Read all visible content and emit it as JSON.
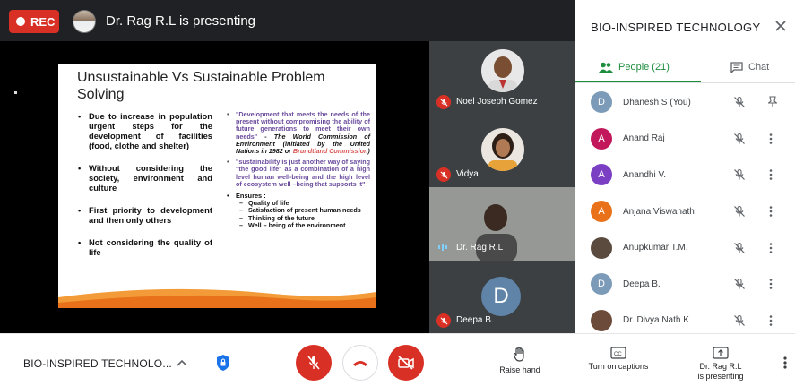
{
  "topbar": {
    "rec_label": "REC",
    "presenting_text": "Dr. Rag R.L is presenting"
  },
  "slide": {
    "title": "Unsustainable Vs Sustainable Problem Solving",
    "bullets": [
      "Due to increase in population urgent steps for the development of facilities (food, clothe and shelter)",
      "Without considering the society, environment and culture",
      "First priority to development and then only others",
      "Not considering the quality of life"
    ],
    "quote1": "\"Development that meets the needs of the present without compromising the ability of future generations to meet their own needs\"",
    "quote1_attr": " - The World Commission of Environment (initiated by the United Nations in 1982 or ",
    "quote1_red": "Brundtland Commission",
    "quote1_close": ")",
    "quote2": "\"sustainability is just another way of saying \"the good life\" as a combination of a high level human well-being and the high level of ecosystem well –being that supports it\"",
    "ensures_label": "Ensures :",
    "ensures": [
      "Quality of life",
      "Satisfaction of present human needs",
      "Thinking of the future",
      "Well – being of the environment"
    ]
  },
  "tiles": {
    "noel": "Noel Joseph Gomez",
    "vidya": "Vidya",
    "rag": "Dr. Rag R.L",
    "deepa": "Deepa B.",
    "deepa_initial": "D"
  },
  "panel": {
    "title": "BIO-INSPIRED TECHNOLOGY",
    "people_tab": "People (21)",
    "chat_tab": "Chat",
    "participants": [
      {
        "name": "Dhanesh S (You)",
        "initial": "D",
        "color": "#7b9bb8"
      },
      {
        "name": "Anand Raj",
        "initial": "A",
        "color": "#c2185b"
      },
      {
        "name": "Anandhi V.",
        "initial": "A",
        "color": "#7b3fc4"
      },
      {
        "name": "Anjana Viswanath",
        "initial": "A",
        "color": "#e8711a"
      },
      {
        "name": "Anupkumar T.M.",
        "initial": "",
        "color": "#5b4a3e"
      },
      {
        "name": "Deepa B.",
        "initial": "D",
        "color": "#7b9bb8"
      },
      {
        "name": "Dr. Divya Nath K",
        "initial": "",
        "color": "#6d4b3a"
      }
    ]
  },
  "bottom": {
    "meeting_name": "BIO-INSPIRED TECHNOLO...",
    "raise_hand": "Raise hand",
    "captions": "Turn on captions",
    "present_line1": "Dr. Rag R.L",
    "present_line2": "is presenting"
  },
  "colors": {
    "danger": "#d93025",
    "people_green": "#1e8e3e",
    "stage_bg": "#202124"
  }
}
